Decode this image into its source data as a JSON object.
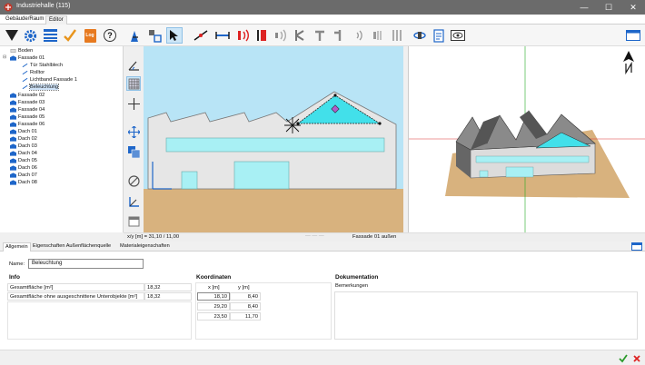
{
  "window": {
    "title": "Industriehalle (115)"
  },
  "main_tabs": [
    "Gebäude/Raum",
    "Editor"
  ],
  "tree": {
    "items": [
      {
        "label": "Boden"
      },
      {
        "label": "Fassade 01"
      },
      {
        "label": "Tür Stahlblech"
      },
      {
        "label": "Rolltor"
      },
      {
        "label": "Lichtband Fassade 1"
      },
      {
        "label": "Beleuchtung"
      },
      {
        "label": "Fassade 02"
      },
      {
        "label": "Fassade 03"
      },
      {
        "label": "Fassade 04"
      },
      {
        "label": "Fassade 05"
      },
      {
        "label": "Fassade 06"
      },
      {
        "label": "Dach 01"
      },
      {
        "label": "Dach 02"
      },
      {
        "label": "Dach 03"
      },
      {
        "label": "Dach 04"
      },
      {
        "label": "Dach 05"
      },
      {
        "label": "Dach 06"
      },
      {
        "label": "Dach 07"
      },
      {
        "label": "Dach 08"
      }
    ]
  },
  "toolbar": {
    "log_label": "Log",
    "help_label": "?"
  },
  "status": {
    "coords": "x/y [m] = 31,10 / 11,00",
    "view_name": "Fassade 01 außen"
  },
  "props": {
    "tabs": [
      "Allgemein",
      "Eigenschaften Außenflächenquelle",
      "Materialeigenschaften"
    ],
    "name_label": "Name:",
    "name_value": "Beleuchtung",
    "info": {
      "title": "Info",
      "rows": [
        {
          "label": "Gesamtfläche [m²]",
          "value": "18,32"
        },
        {
          "label": "Gesamtfläche ohne ausgeschnittene Unterobjekte [m²]",
          "value": "18,32"
        }
      ]
    },
    "coords": {
      "title": "Koordinaten",
      "headers": [
        "x [m]",
        "y [m]"
      ],
      "rows": [
        [
          "18,10",
          "8,40"
        ],
        [
          "29,20",
          "8,40"
        ],
        [
          "23,50",
          "11,70"
        ]
      ]
    },
    "doc": {
      "title": "Dokumentation",
      "remarks_label": "Bemerkungen"
    }
  },
  "colors": {
    "accent": "#1e7bd6",
    "sky": "#b8e4f6",
    "ground": "#d8b27e",
    "wall": "#e6e6e6",
    "glass": "#a8f0f4",
    "lighting": "#42e0ea"
  }
}
